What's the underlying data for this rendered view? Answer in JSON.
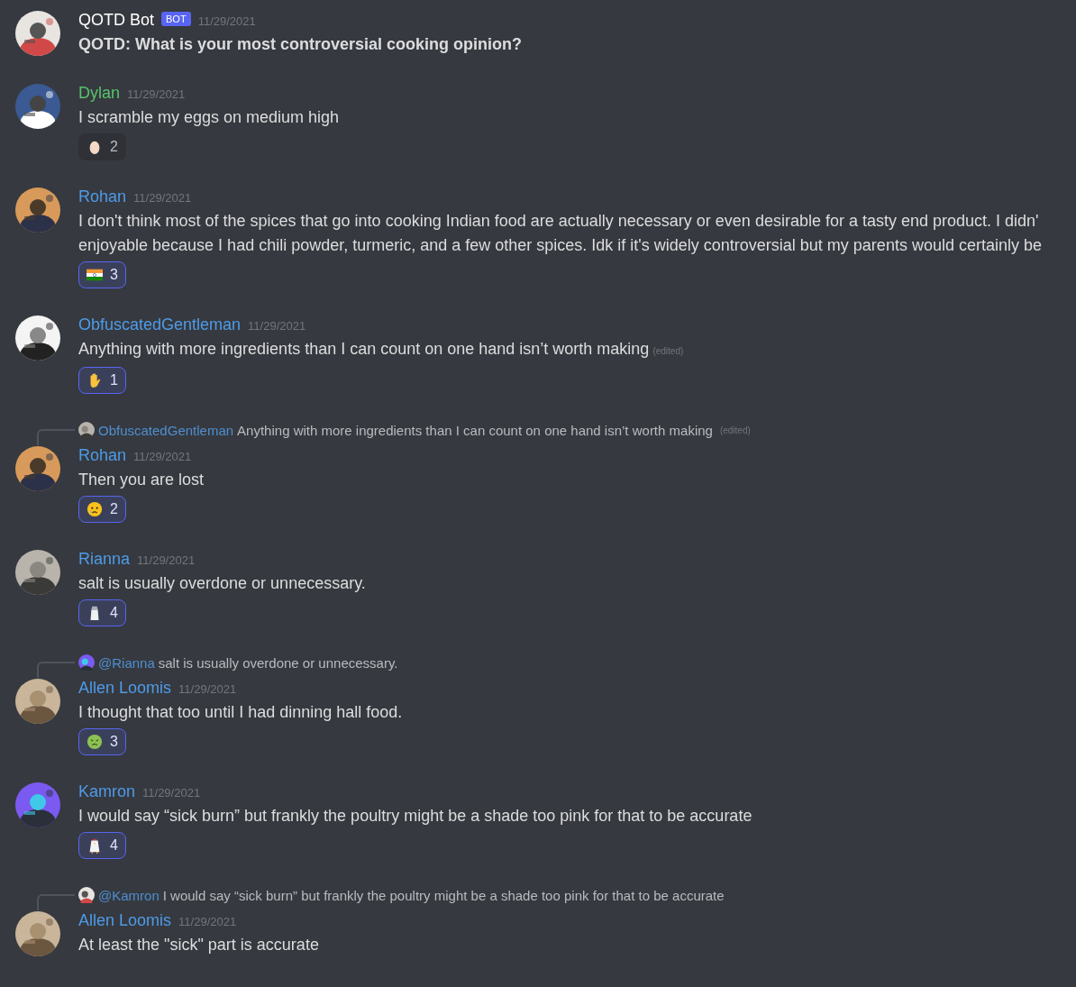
{
  "messages": [
    {
      "kind": "bot",
      "author": "QOTD Bot",
      "color": "#ffffff",
      "tag": "BOT",
      "timestamp": "11/29/2021",
      "lines": [
        "QOTD: What is your most controversial cooking opinion?"
      ]
    },
    {
      "kind": "user",
      "author": "Dylan",
      "color": "#57c46b",
      "timestamp": "11/29/2021",
      "lines": [
        "I scramble my eggs on medium high"
      ],
      "reactions": [
        {
          "kind": "egg",
          "count": "2",
          "selected": false
        }
      ]
    },
    {
      "kind": "user",
      "author": "Rohan",
      "color": "#4e9be8",
      "timestamp": "11/29/2021",
      "lines": [
        "I don't think most of the spices that go into cooking Indian food are actually necessary or even desirable for a tasty end product. I didn'",
        "enjoyable because I had chili powder, turmeric, and a few other spices. Idk if it's widely controversial but my parents would certainly be"
      ],
      "reactions": [
        {
          "kind": "flag",
          "count": "3",
          "selected": true
        }
      ]
    },
    {
      "kind": "user",
      "author": "ObfuscatedGentleman",
      "color": "#4e9be8",
      "timestamp": "11/29/2021",
      "lines": [
        "Anything with more ingredients than I can count on one hand isn’t worth making"
      ],
      "edited": "(edited)",
      "reactions": [
        {
          "kind": "hand",
          "count": "1",
          "selected": true
        }
      ]
    },
    {
      "kind": "user",
      "reply": {
        "author": "ObfuscatedGentleman",
        "text": "Anything with more ingredients than I can count on one hand isn’t worth making",
        "edited": "(edited)"
      },
      "author": "Rohan",
      "color": "#4e9be8",
      "timestamp": "11/29/2021",
      "lines": [
        "Then you are lost"
      ],
      "reactions": [
        {
          "kind": "crying",
          "count": "2",
          "selected": true
        }
      ]
    },
    {
      "kind": "user",
      "author": "Rianna",
      "color": "#4e9be8",
      "timestamp": "11/29/2021",
      "lines": [
        "salt is usually overdone or unnecessary."
      ],
      "reactions": [
        {
          "kind": "salt",
          "count": "4",
          "selected": true
        }
      ]
    },
    {
      "kind": "user",
      "reply": {
        "author": "@Rianna",
        "text": "salt is usually overdone or unnecessary."
      },
      "author": "Allen Loomis",
      "color": "#4e9be8",
      "timestamp": "11/29/2021",
      "lines": [
        "I thought that too until I had dinning hall food."
      ],
      "reactions": [
        {
          "kind": "nauseated",
          "count": "3",
          "selected": true
        }
      ]
    },
    {
      "kind": "user",
      "author": "Kamron",
      "color": "#4e9be8",
      "timestamp": "11/29/2021",
      "lines": [
        "I would say “sick burn” but frankly the poultry might be a shade too pink for that to be accurate"
      ],
      "reactions": [
        {
          "kind": "chicken",
          "count": "4",
          "selected": true
        }
      ]
    },
    {
      "kind": "user",
      "reply": {
        "author": "@Kamron",
        "text": "I would say “sick burn” but frankly the poultry might be a shade too pink for that to be accurate"
      },
      "author": "Allen Loomis",
      "color": "#4e9be8",
      "timestamp": "11/29/2021",
      "lines": [
        "At least the \"sick\" part is accurate"
      ]
    }
  ]
}
